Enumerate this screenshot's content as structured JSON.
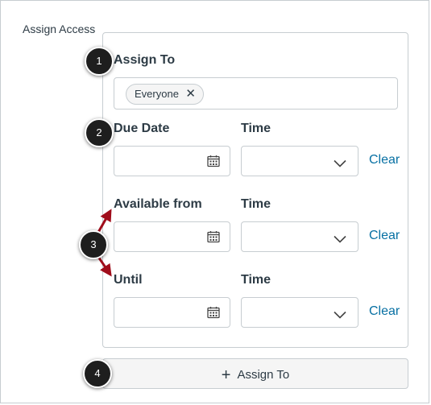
{
  "section": {
    "label": "Assign Access"
  },
  "assign_to": {
    "label": "Assign To",
    "tags": [
      {
        "text": "Everyone",
        "remove_glyph": "✕"
      }
    ]
  },
  "rows": [
    {
      "date_label": "Due Date",
      "time_label": "Time",
      "clear_label": "Clear"
    },
    {
      "date_label": "Available from",
      "time_label": "Time",
      "clear_label": "Clear"
    },
    {
      "date_label": "Until",
      "time_label": "Time",
      "clear_label": "Clear"
    }
  ],
  "add_button": {
    "plus": "+",
    "label": "Assign To"
  },
  "callouts": [
    "1",
    "2",
    "3",
    "4"
  ],
  "icons": {
    "calendar": "calendar-icon",
    "chevron": "chevron-down-icon",
    "remove": "close-icon",
    "plus": "plus-icon"
  },
  "colors": {
    "link": "#0770a3",
    "arrow": "#a00d1b",
    "callout": "#1e1e1e"
  }
}
